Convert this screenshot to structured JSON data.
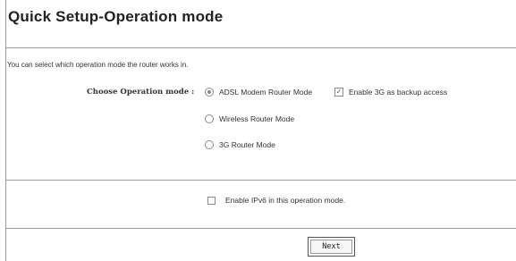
{
  "page": {
    "title": "Quick Setup-Operation mode",
    "intro": "You can select which operation mode the router works in."
  },
  "operation_mode": {
    "label": "Choose Operation mode :",
    "selected": "ADSL Modem Router Mode",
    "options": [
      {
        "label": "ADSL Modem Router Mode",
        "checked": true
      },
      {
        "label": "Wireless Router Mode",
        "checked": false
      },
      {
        "label": "3G Router Mode",
        "checked": false
      }
    ],
    "backup_3g": {
      "label": "Enable 3G as backup access",
      "checked": true
    }
  },
  "ipv6": {
    "label": "Enable IPv6 in this operation mode.",
    "checked": false
  },
  "buttons": {
    "next": "Next"
  },
  "colors": {
    "line": "#9a9a9a",
    "text": "#333333",
    "background": "#ffffff"
  }
}
